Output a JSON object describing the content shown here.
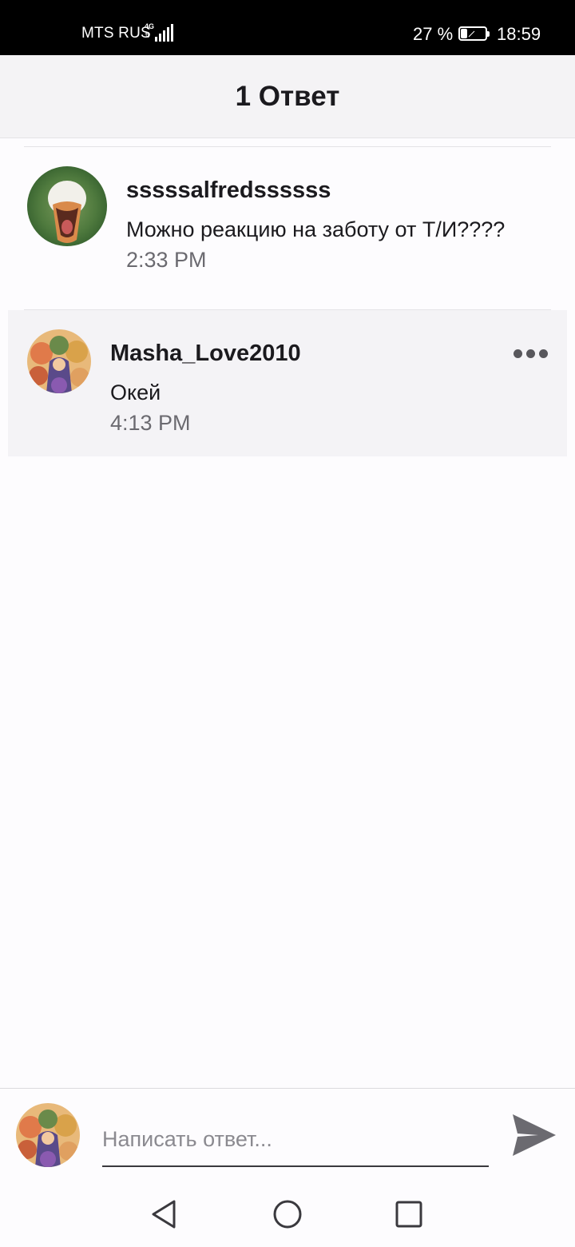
{
  "status_bar": {
    "carrier": "MTS RUS",
    "network_type": "4G",
    "battery_percent": "27 %",
    "battery_level": 0.27,
    "time": "18:59"
  },
  "header": {
    "title": "1 Ответ"
  },
  "comments": [
    {
      "author": "sssssalfredssssss",
      "text": "Можно реакцию на заботу от Т/И????",
      "time": "2:33 PM",
      "avatar_icon": "duck-avatar"
    },
    {
      "author": "Masha_Love2010",
      "text": "Окей",
      "time": "4:13 PM",
      "avatar_icon": "anime-art-avatar",
      "highlighted": true
    }
  ],
  "composer": {
    "placeholder": "Написать ответ...",
    "value": "",
    "send_icon": "send-icon"
  },
  "nav_bar": {
    "icons": [
      "back-icon",
      "home-icon",
      "recents-icon"
    ]
  },
  "colors": {
    "status_bar_bg": "#000000",
    "header_bg": "#f4f3f5",
    "highlight_bg": "#f4f3f6",
    "secondary_text": "#6b6a70"
  }
}
